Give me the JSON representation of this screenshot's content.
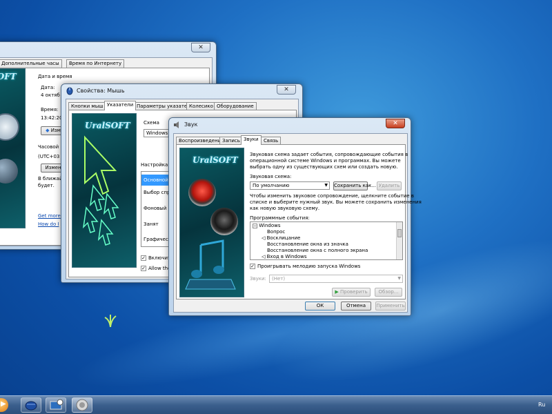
{
  "taskbar": {
    "tray_text": "Ru"
  },
  "time_window": {
    "tabs": [
      "Дополнительные часы",
      "Время по Интернету"
    ],
    "group_title": "Дата и время",
    "date_label": "Дата:",
    "date_value": "4 октяб",
    "time_label": "Время:",
    "time_value": "13:42:20",
    "change_button": "Изм",
    "timezone_label": "Часовой",
    "timezone_value": "(UTC+03",
    "change_tz_button": "Измен",
    "dst_text_1": "В ближай",
    "dst_text_2": "будет.",
    "link_1": "Get more",
    "link_2": "How do I",
    "brand": "UralSOFT"
  },
  "mouse_window": {
    "title": "Свойства: Мышь",
    "tabs": [
      "Кнопки мыш",
      "Указатели",
      "Параметры указателя",
      "Колесико",
      "Оборудование"
    ],
    "scheme_label": "Схема",
    "scheme_value": "Windows A",
    "customize_label": "Настройка:",
    "cursor_items": [
      "Основной ре",
      "Выбор справ",
      "Фоновый ре",
      "Занят",
      "Графическое"
    ],
    "enable_shadow": "Включить т",
    "allow_themes": "Allow theme",
    "brand": "UralSOFT"
  },
  "sound_window": {
    "title": "Звук",
    "tabs": [
      "Воспроизведение",
      "Запись",
      "Звуки",
      "Связь"
    ],
    "description": [
      "Звуковая схема задает события, сопровождающие события в",
      "операционной системе Windows и программах. Вы можете",
      "выбрать одну из существующих схем или создать новую."
    ],
    "scheme_label": "Звуковая схема:",
    "scheme_value": "По умолчанию",
    "save_as_button": "Сохранить как...",
    "delete_button": "Удалить",
    "hint": [
      "Чтобы изменить звуковое сопровождение, щелкните событие в",
      "списке и выберите нужный звук. Вы можете сохранить изменения",
      "как новую звуковую схему."
    ],
    "events_label": "Программные события:",
    "events": [
      "Windows",
      "Вопрос",
      "Восклицание",
      "Восстановление окна из значка",
      "Восстановление окна с полного экрана",
      "Вход в Windows"
    ],
    "startup_checkbox": "Проигрывать мелодию запуска Windows",
    "sounds_label": "Звуки:",
    "sounds_value": "(Нет)",
    "test_button": "Проверить",
    "browse_button": "Обзор...",
    "ok_button": "ОК",
    "cancel_button": "Отмена",
    "apply_button": "Применить",
    "brand": "UralSOFT"
  }
}
